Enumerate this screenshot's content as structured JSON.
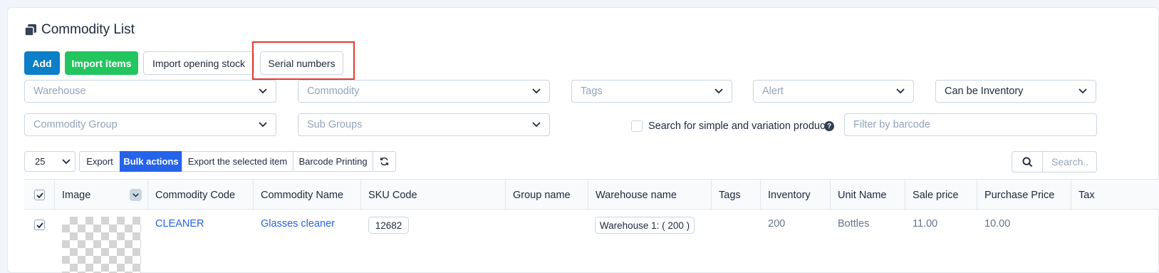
{
  "header": {
    "title": "Commodity List"
  },
  "actions": {
    "add": "Add",
    "import_items": "Import items",
    "import_opening_stock": "Import opening stock",
    "serial_numbers": "Serial numbers"
  },
  "filters": {
    "warehouse": "Warehouse",
    "commodity": "Commodity",
    "tags": "Tags",
    "alert": "Alert",
    "inventory": "Can be Inventory",
    "commodity_group": "Commodity Group",
    "sub_groups": "Sub Groups",
    "simple_variation_label": "Search for simple and variation product",
    "barcode_placeholder": "Filter by barcode"
  },
  "toolbar": {
    "page_size": "25",
    "export": "Export",
    "bulk_actions": "Bulk actions",
    "export_selected": "Export the selected item",
    "barcode_printing": "Barcode Printing",
    "search_placeholder": "Search.."
  },
  "table": {
    "columns": [
      "Image",
      "Commodity Code",
      "Commodity Name",
      "SKU Code",
      "Group name",
      "Warehouse name",
      "Tags",
      "Inventory",
      "Unit Name",
      "Sale price",
      "Purchase Price",
      "Tax"
    ],
    "rows": [
      {
        "code": "CLEANER",
        "name": "Glasses cleaner",
        "sku": "12682",
        "group": "",
        "warehouse": "Warehouse 1: ( 200 )",
        "tags": "",
        "inventory": "200",
        "unit": "Bottles",
        "sale_price": "11.00",
        "purchase_price": "10.00"
      }
    ]
  },
  "colors": {
    "primary": "#0b7fc7",
    "success": "#22c55e",
    "bulk": "#2563eb",
    "highlight": "#e53935"
  }
}
